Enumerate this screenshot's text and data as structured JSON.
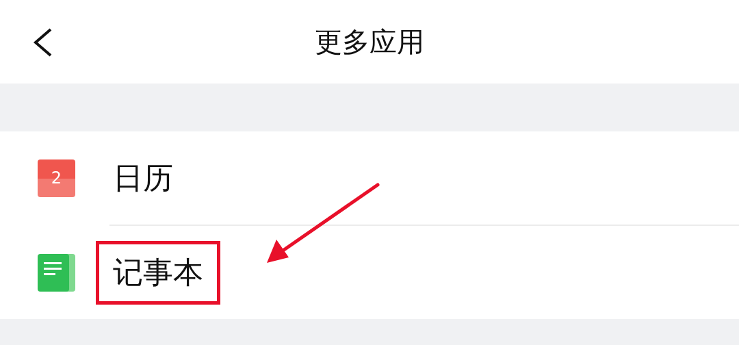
{
  "header": {
    "title": "更多应用"
  },
  "items": [
    {
      "kind": "calendar",
      "badge": "2",
      "label": "日历",
      "highlighted": false,
      "arrow": false
    },
    {
      "kind": "notes",
      "label": "记事本",
      "highlighted": true,
      "arrow": true
    }
  ]
}
